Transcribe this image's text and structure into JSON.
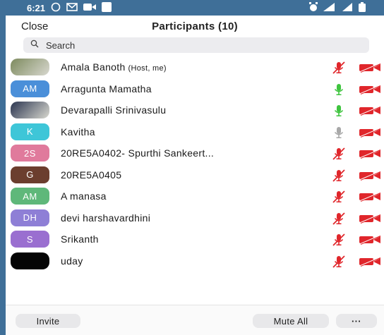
{
  "status_bar": {
    "time": "6:21"
  },
  "header": {
    "close_label": "Close",
    "title": "Participants (10)"
  },
  "search": {
    "placeholder": "Search"
  },
  "participants": [
    {
      "name": "Amala Banoth",
      "tag": "(Host, me)",
      "initials": "",
      "avatar_type": "photo",
      "avatar_color": "#7d8a5e",
      "mic": "muted",
      "video": "off"
    },
    {
      "name": "Arragunta Mamatha",
      "tag": "",
      "initials": "AM",
      "avatar_type": "initials",
      "avatar_color": "#4a8fd9",
      "mic": "on",
      "video": "off"
    },
    {
      "name": "Devarapalli Srinivasulu",
      "tag": "",
      "initials": "",
      "avatar_type": "photo",
      "avatar_color": "#2b3550",
      "mic": "on",
      "video": "off"
    },
    {
      "name": "Kavitha",
      "tag": "",
      "initials": "K",
      "avatar_type": "initials",
      "avatar_color": "#3ec6d8",
      "mic": "idle",
      "video": "off"
    },
    {
      "name": "20RE5A0402- Spurthi Sankeert...",
      "tag": "",
      "initials": "2S",
      "avatar_type": "initials",
      "avatar_color": "#e07a9c",
      "mic": "muted",
      "video": "off"
    },
    {
      "name": "20RE5A0405",
      "tag": "",
      "initials": "G",
      "avatar_type": "initials",
      "avatar_color": "#6b3e2e",
      "mic": "muted",
      "video": "off"
    },
    {
      "name": "A manasa",
      "tag": "",
      "initials": "AM",
      "avatar_type": "initials",
      "avatar_color": "#5fb87a",
      "mic": "muted",
      "video": "off"
    },
    {
      "name": "devi harshavardhini",
      "tag": "",
      "initials": "DH",
      "avatar_type": "initials",
      "avatar_color": "#8e7fd6",
      "mic": "muted",
      "video": "off"
    },
    {
      "name": "Srikanth",
      "tag": "",
      "initials": "S",
      "avatar_type": "initials",
      "avatar_color": "#9a6fd0",
      "mic": "muted",
      "video": "off"
    },
    {
      "name": "uday",
      "tag": "",
      "initials": "",
      "avatar_type": "photo",
      "avatar_color": "#050505",
      "mic": "muted",
      "video": "off"
    }
  ],
  "footer": {
    "invite_label": "Invite",
    "mute_all_label": "Mute All",
    "more_label": "···"
  },
  "colors": {
    "mic_on": "#3fc43f",
    "muted_red": "#e0262b",
    "idle_gray": "#a8a8a8"
  }
}
